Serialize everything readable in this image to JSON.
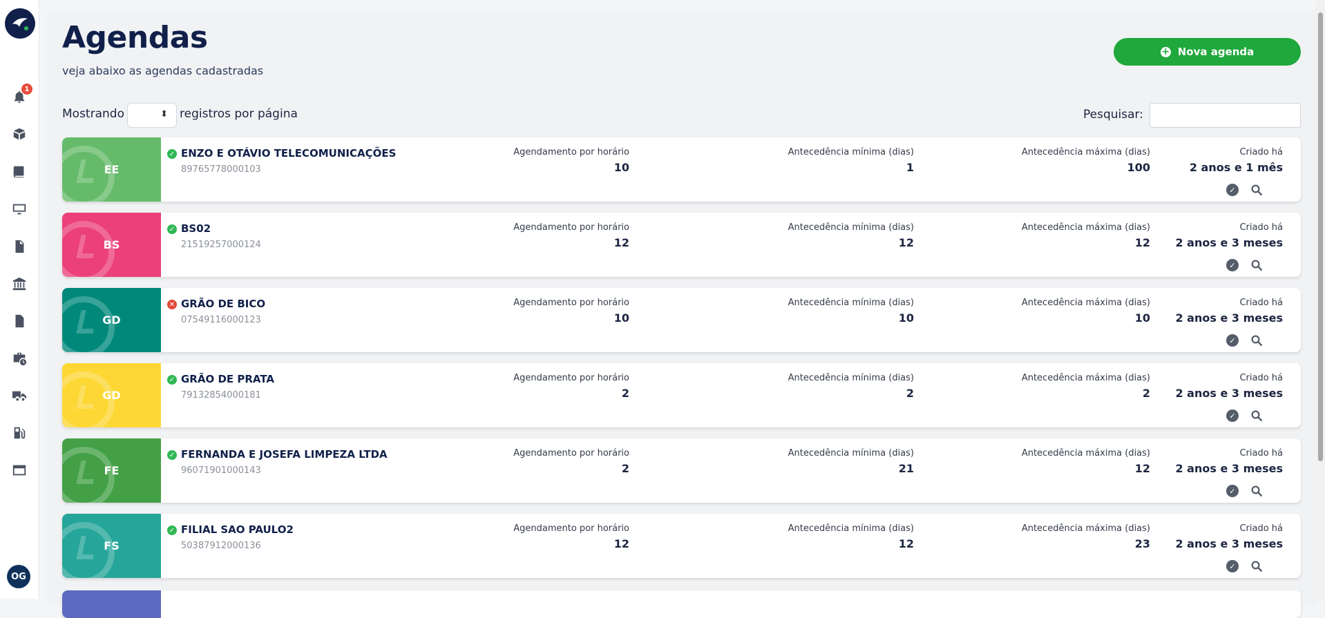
{
  "sidebar": {
    "notification_count": "1",
    "user_initials": "OG",
    "icons": [
      "bell-icon",
      "box-icon",
      "book-icon",
      "monitor-icon",
      "file-icon",
      "bank-icon",
      "document-icon",
      "briefcase-clock-icon",
      "truck-icon",
      "fuel-icon",
      "window-icon"
    ]
  },
  "header": {
    "title": "Agendas",
    "subtitle": "veja abaixo as agendas cadastradas",
    "new_button_label": "Nova agenda"
  },
  "controls": {
    "showing_label": "Mostrando",
    "per_page_value": "",
    "per_page_label": "registros por página",
    "search_label": "Pesquisar:",
    "search_value": ""
  },
  "columns": {
    "by_hour": "Agendamento por horário",
    "min_advance": "Antecedência mínima (dias)",
    "max_advance": "Antecedência máxima (dias)",
    "created": "Criado há"
  },
  "agendas": [
    {
      "initials": "EE",
      "name": "ENZO E OTÁVIO TELECOMUNICAÇÕES",
      "cnpj": "89765778000103",
      "by_hour": "10",
      "min_advance": "1",
      "max_advance": "100",
      "created": "2 anos e 1 mês",
      "status": "ok",
      "color": "#66bb6a"
    },
    {
      "initials": "BS",
      "name": "BS02",
      "cnpj": "21519257000124",
      "by_hour": "12",
      "min_advance": "12",
      "max_advance": "12",
      "created": "2 anos e 3 meses",
      "status": "ok",
      "color": "#ec407a"
    },
    {
      "initials": "GD",
      "name": "GRÃO DE BICO",
      "cnpj": "07549116000123",
      "by_hour": "10",
      "min_advance": "10",
      "max_advance": "10",
      "created": "2 anos e 3 meses",
      "status": "err",
      "color": "#00897b"
    },
    {
      "initials": "GD",
      "name": "GRÃO DE PRATA",
      "cnpj": "79132854000181",
      "by_hour": "2",
      "min_advance": "2",
      "max_advance": "2",
      "created": "2 anos e 3 meses",
      "status": "ok",
      "color": "#fdd835"
    },
    {
      "initials": "FE",
      "name": "FERNANDA E JOSEFA LIMPEZA LTDA",
      "cnpj": "96071901000143",
      "by_hour": "2",
      "min_advance": "21",
      "max_advance": "12",
      "created": "2 anos e 3 meses",
      "status": "ok",
      "color": "#43a047"
    },
    {
      "initials": "FS",
      "name": "FILIAL SAO PAULO2",
      "cnpj": "50387912000136",
      "by_hour": "12",
      "min_advance": "12",
      "max_advance": "23",
      "created": "2 anos e 3 meses",
      "status": "ok",
      "color": "#26a69a"
    }
  ]
}
